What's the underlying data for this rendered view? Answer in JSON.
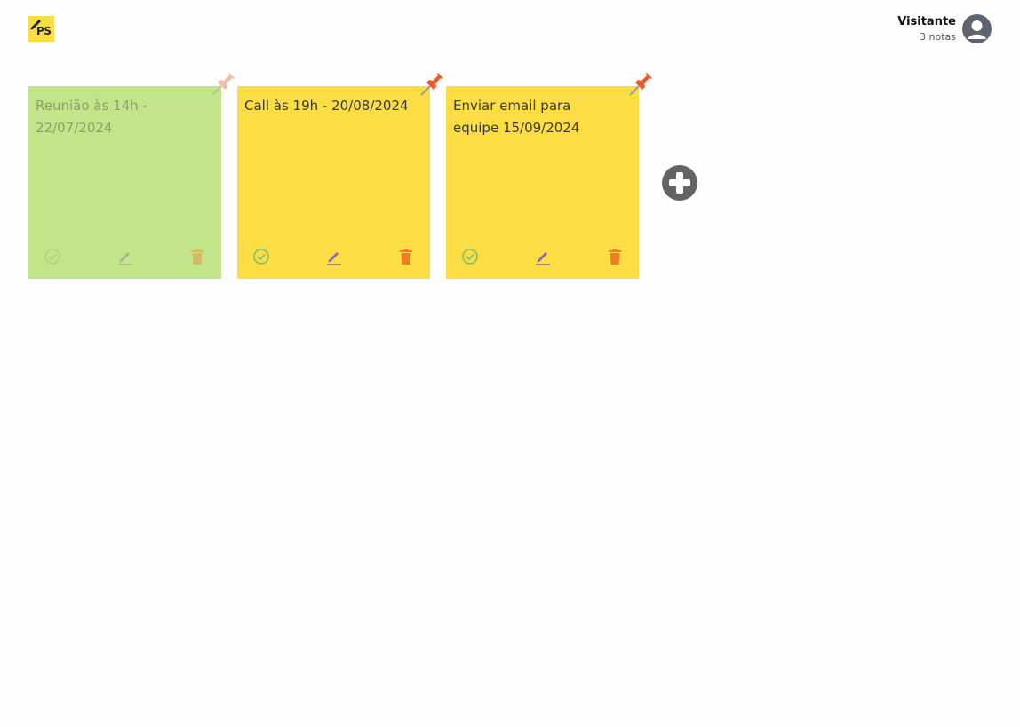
{
  "app": {
    "logo_text": "PS",
    "logo_icon": "pencil-icon"
  },
  "user": {
    "name": "Visitante",
    "count": "3 notas",
    "avatar_icon": "user-avatar-icon"
  },
  "notes": [
    {
      "text": "Reunião às 14h - 22/07/2024",
      "color": "#c3e58a",
      "done": true
    },
    {
      "text": "Call às 19h - 20/08/2024",
      "color": "#fcdd44",
      "done": false
    },
    {
      "text": "Enviar email para equipe 15/09/2024",
      "color": "#fcdd44",
      "done": false
    }
  ],
  "icons": {
    "pin": "pushpin-icon",
    "complete": "check-circle-icon",
    "edit": "pencil-icon",
    "delete": "trash-icon",
    "add": "plus-circle-icon"
  },
  "colors": {
    "pin": "#ef5a2b",
    "check": "#8dc06a",
    "edit": "#8a6bb0",
    "delete": "#ef7d23",
    "add": "#636363"
  }
}
